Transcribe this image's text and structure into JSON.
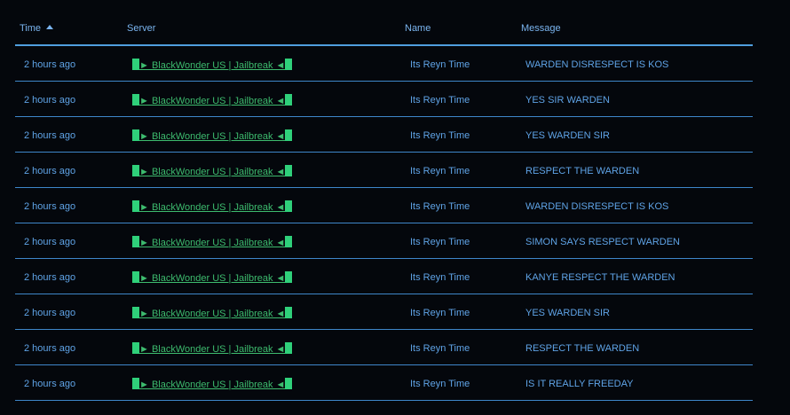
{
  "header": {
    "time": "Time",
    "server": "Server",
    "name": "Name",
    "message": "Message"
  },
  "rows": [
    {
      "time": "2 hours ago",
      "server": "► BlackWonder US | Jailbreak ◄",
      "name": "Its Reyn Time",
      "message": "WARDEN DISRESPECT IS KOS"
    },
    {
      "time": "2 hours ago",
      "server": "► BlackWonder US | Jailbreak ◄",
      "name": "Its Reyn Time",
      "message": "YES SIR WARDEN"
    },
    {
      "time": "2 hours ago",
      "server": "► BlackWonder US | Jailbreak ◄",
      "name": "Its Reyn Time",
      "message": "YES WARDEN SIR"
    },
    {
      "time": "2 hours ago",
      "server": "► BlackWonder US | Jailbreak ◄",
      "name": "Its Reyn Time",
      "message": "RESPECT THE WARDEN"
    },
    {
      "time": "2 hours ago",
      "server": "► BlackWonder US | Jailbreak ◄",
      "name": "Its Reyn Time",
      "message": "WARDEN DISRESPECT IS KOS"
    },
    {
      "time": "2 hours ago",
      "server": "► BlackWonder US | Jailbreak ◄",
      "name": "Its Reyn Time",
      "message": "SIMON SAYS RESPECT WARDEN"
    },
    {
      "time": "2 hours ago",
      "server": "► BlackWonder US | Jailbreak ◄",
      "name": "Its Reyn Time",
      "message": "KANYE RESPECT THE WARDEN"
    },
    {
      "time": "2 hours ago",
      "server": "► BlackWonder US | Jailbreak ◄",
      "name": "Its Reyn Time",
      "message": "YES WARDEN SIR"
    },
    {
      "time": "2 hours ago",
      "server": "► BlackWonder US | Jailbreak ◄",
      "name": "Its Reyn Time",
      "message": "RESPECT THE WARDEN"
    },
    {
      "time": "2 hours ago",
      "server": "► BlackWonder US | Jailbreak ◄",
      "name": "Its Reyn Time",
      "message": "IS IT REALLY FREEDAY"
    }
  ],
  "colors": {
    "background": "#04070c",
    "text": "#5fa3e6",
    "divider": "#3e86c9",
    "server_link": "#3dbb6e",
    "server_block": "#2fd07a"
  },
  "icons": {
    "sort": "sort-ascending-icon",
    "server_block": "green-block-glyph"
  }
}
